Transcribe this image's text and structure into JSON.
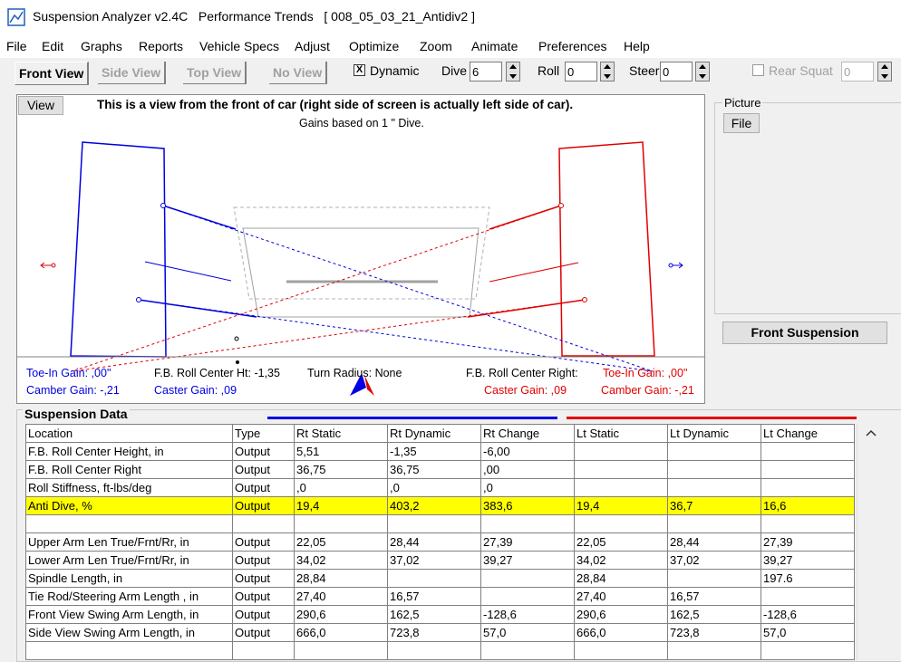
{
  "window": {
    "title": "Suspension Analyzer v2.4C   Performance Trends   [ 008_05_03_21_Antidiv2 ]"
  },
  "menu": [
    "File",
    "Edit",
    "Graphs",
    "Reports",
    "Vehicle Specs",
    "Adjust",
    "Optimize",
    "Zoom",
    "Animate",
    "Preferences",
    "Help"
  ],
  "toolbar": {
    "tabs": [
      "Front View",
      "Side View",
      "Top View",
      "No View"
    ],
    "dynamic_label": "Dynamic",
    "dynamic_checked": "X",
    "dive_label": "Dive",
    "dive_value": "6",
    "roll_label": "Roll",
    "roll_value": "0",
    "steer_label": "Steer",
    "steer_value": "0",
    "rear_squat_label": "Rear Squat",
    "rear_squat_value": "0"
  },
  "view": {
    "button": "View",
    "heading": "This is a view from the front of car (right side of screen is actually left side of car).",
    "subheading": "Gains based on 1 \" Dive.",
    "toe_in_left": "Toe-In Gain: ,00\"",
    "camber_left": "Camber Gain: -,21",
    "fb_roll_ht": "F.B. Roll Center Ht: -1,35",
    "caster_left": "Caster Gain: ,09",
    "turn_radius": "Turn Radius: None",
    "fb_roll_right": "F.B. Roll Center Right:",
    "toe_in_right": "Toe-In Gain: ,00\"",
    "caster_right": "Caster Gain: ,09",
    "camber_right": "Camber Gain: -,21"
  },
  "picture": {
    "label": "Picture",
    "file_button": "File"
  },
  "front_suspension_button": "Front Suspension",
  "suspension_data": {
    "label": "Suspension Data",
    "headers": [
      "Location",
      "Type",
      "Rt Static",
      "Rt Dynamic",
      "Rt Change",
      "Lt Static",
      "Lt Dynamic",
      "Lt Change"
    ],
    "rows": [
      [
        "F.B. Roll Center Height, in",
        "Output",
        "5,51",
        "-1,35",
        "-6,00",
        "",
        "",
        ""
      ],
      [
        "F.B. Roll Center Right",
        "Output",
        "36,75",
        "36,75",
        ",00",
        "",
        "",
        ""
      ],
      [
        "Roll Stiffness, ft-lbs/deg",
        "Output",
        ",0",
        ",0",
        ",0",
        "",
        "",
        ""
      ],
      [
        "Anti Dive, %",
        "Output",
        "19,4",
        "403,2",
        "383,6",
        "19,4",
        "36,7",
        "16,6"
      ],
      [
        "",
        "",
        "",
        "",
        "",
        "",
        "",
        ""
      ],
      [
        "Upper Arm Len True/Frnt/Rr, in",
        "Output",
        "22,05",
        "28,44",
        "27,39",
        "22,05",
        "28,44",
        "27,39"
      ],
      [
        "Lower Arm Len True/Frnt/Rr, in",
        "Output",
        "34,02",
        "37,02",
        "39,27",
        "34,02",
        "37,02",
        "39,27"
      ],
      [
        "Spindle Length, in",
        "Output",
        "28,84",
        "",
        "",
        "28,84",
        "",
        "197.6"
      ],
      [
        "Tie Rod/Steering Arm Length , in",
        "Output",
        "27,40",
        "16,57",
        "",
        "27,40",
        "16,57",
        ""
      ],
      [
        "Front View Swing Arm Length, in",
        "Output",
        "290,6",
        "162,5",
        "-128,6",
        "290,6",
        "162,5",
        "-128,6"
      ],
      [
        "Side View Swing Arm Length, in",
        "Output",
        "666,0",
        "723,8",
        "57,0",
        "666,0",
        "723,8",
        "57,0"
      ],
      [
        "",
        "",
        "",
        "",
        "",
        "",
        "",
        ""
      ]
    ]
  },
  "colors": {
    "right_side": "#0000e0",
    "left_side": "#e00000",
    "highlight": "#ffff00"
  }
}
